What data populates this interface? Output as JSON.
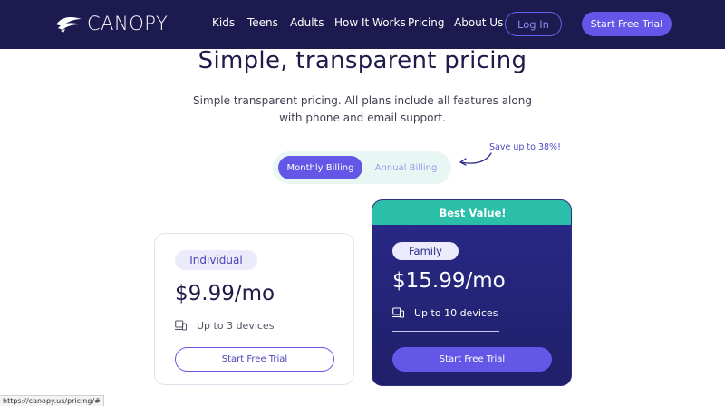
{
  "brand": {
    "name": "CANOPY"
  },
  "nav": {
    "links": [
      "Kids",
      "Teens",
      "Adults",
      "How It Works",
      "Pricing",
      "About Us"
    ],
    "login_label": "Log In",
    "trial_label": "Start Free Trial"
  },
  "hero": {
    "title": "Simple, transparent pricing",
    "subtitle": "Simple transparent pricing. All plans include all features along with phone and email support."
  },
  "billing": {
    "monthly_label": "Monthly Billing",
    "annual_label": "Annual Billing",
    "save_note": "Save up to 38%!"
  },
  "plans": {
    "individual": {
      "name": "Individual",
      "price": "$9.99/mo",
      "devices": "Up to 3 devices",
      "cta": "Start Free Trial"
    },
    "family": {
      "banner": "Best Value!",
      "name": "Family",
      "price": "$15.99/mo",
      "devices": "Up to 10 devices",
      "cta": "Start Free Trial"
    }
  },
  "status": {
    "url": "https://canopy.us/pricing/#"
  },
  "colors": {
    "header_bg": "#1c1a4e",
    "accent": "#6456e6",
    "teal": "#2bbfa9",
    "family_card": "#2a2a8a"
  }
}
